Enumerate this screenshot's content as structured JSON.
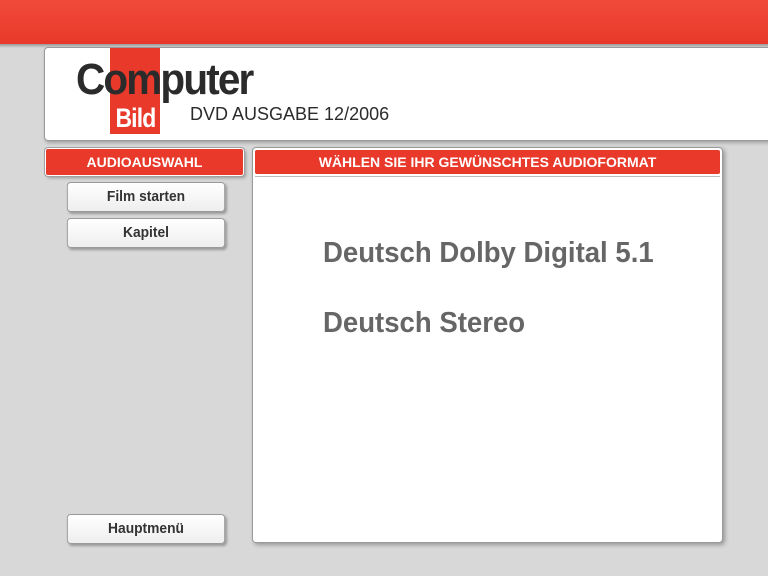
{
  "brand": {
    "logo_computer": "Computer",
    "logo_bild": "Bild",
    "edition": "DVD AUSGABE 12/2006"
  },
  "colors": {
    "accent_red": "#e8392b",
    "panel_white": "#ffffff",
    "background_gray": "#d8d8d8",
    "option_text": "#666666"
  },
  "menu": {
    "active_label": "AUDIOAUSWAHL",
    "film_start": "Film starten",
    "chapters": "Kapitel",
    "main_menu": "Hauptmenü"
  },
  "content": {
    "heading": "WÄHLEN SIE IHR GEWÜNSCHTES AUDIOFORMAT",
    "options": [
      {
        "label": "Deutsch Dolby Digital 5.1"
      },
      {
        "label": "Deutsch Stereo"
      }
    ]
  }
}
